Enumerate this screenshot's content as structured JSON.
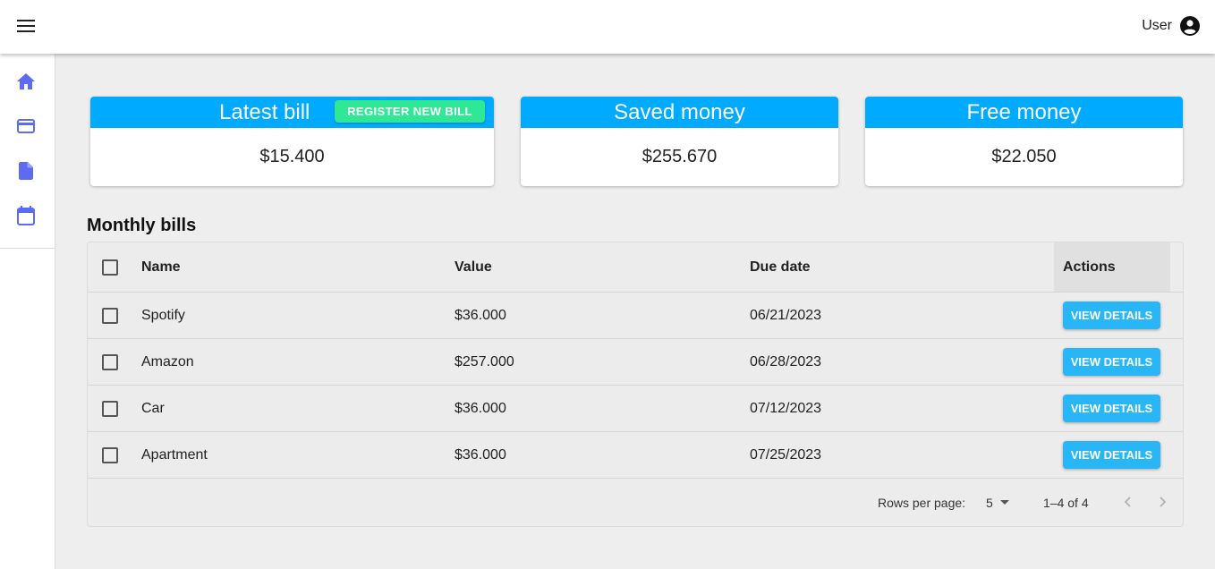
{
  "header": {
    "user_label": "User"
  },
  "icons": {
    "menu": "menu-icon",
    "account": "account-circle-icon",
    "home": "home-icon",
    "card": "credit-card-icon",
    "file": "file-icon",
    "calendar": "calendar-icon"
  },
  "colors": {
    "accent": "#00aaff",
    "nav_icon": "#5c6bf0",
    "register_button": "#2ee896",
    "view_button": "#29b6f6"
  },
  "cards": [
    {
      "title": "Latest bill",
      "value": "$15.400",
      "button_label": "REGISTER NEW BILL"
    },
    {
      "title": "Saved money",
      "value": "$255.670"
    },
    {
      "title": "Free money",
      "value": "$22.050"
    }
  ],
  "bills": {
    "title": "Monthly bills",
    "columns": {
      "name": "Name",
      "value": "Value",
      "due": "Due date",
      "actions": "Actions"
    },
    "rows": [
      {
        "name": "Spotify",
        "value": "$36.000",
        "due": "06/21/2023",
        "action": "VIEW DETAILS"
      },
      {
        "name": "Amazon",
        "value": "$257.000",
        "due": "06/28/2023",
        "action": "VIEW DETAILS"
      },
      {
        "name": "Car",
        "value": "$36.000",
        "due": "07/12/2023",
        "action": "VIEW DETAILS"
      },
      {
        "name": "Apartment",
        "value": "$36.000",
        "due": "07/25/2023",
        "action": "VIEW DETAILS"
      }
    ],
    "pagination": {
      "rows_per_page_label": "Rows per page:",
      "rows_per_page": "5",
      "range": "1–4 of 4"
    }
  }
}
